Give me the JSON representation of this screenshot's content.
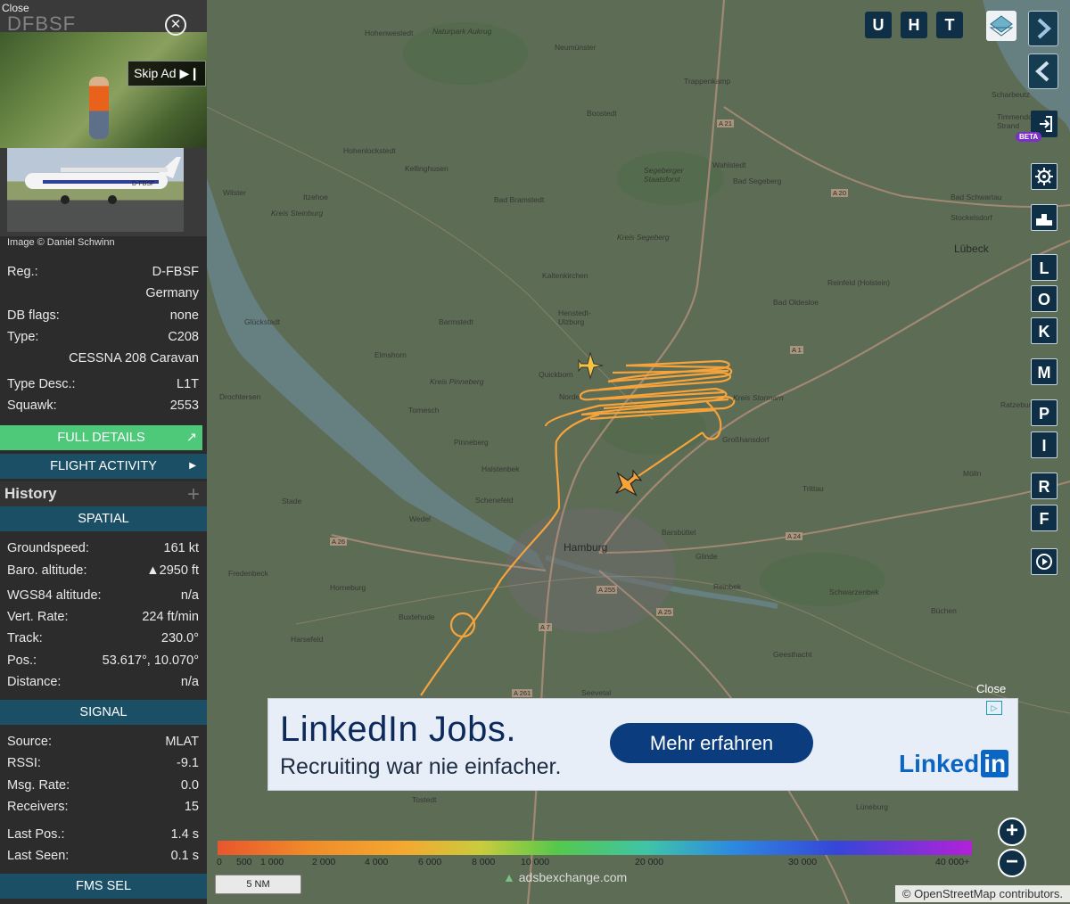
{
  "sidebar": {
    "ad": {
      "close_text": "Close",
      "ghost_text": "DFBSF",
      "skip_label": "Skip Ad"
    },
    "photo_credit": "Image © Daniel Schwinn",
    "aircraft": {
      "reg_label": "Reg.:",
      "reg_value": "D-FBSF",
      "country": "Germany",
      "dbflags_label": "DB flags:",
      "dbflags_value": "none",
      "type_label": "Type:",
      "type_value": "C208",
      "type_name": "CESSNA 208 Caravan",
      "typedesc_label": "Type Desc.:",
      "typedesc_value": "L1T",
      "squawk_label": "Squawk:",
      "squawk_value": "2553"
    },
    "full_details_label": "FULL DETAILS",
    "flight_activity_label": "FLIGHT ACTIVITY",
    "history_label": "History",
    "spatial": {
      "header": "SPATIAL",
      "groundspeed_label": "Groundspeed:",
      "groundspeed_value": "161 kt",
      "baro_label": "Baro. altitude:",
      "baro_value": "▲2950 ft",
      "wgs_label": "WGS84 altitude:",
      "wgs_value": "n/a",
      "vert_label": "Vert. Rate:",
      "vert_value": "224 ft/min",
      "track_label": "Track:",
      "track_value": "230.0°",
      "pos_label": "Pos.:",
      "pos_value": "53.617°, 10.070°",
      "dist_label": "Distance:",
      "dist_value": "n/a"
    },
    "signal": {
      "header": "SIGNAL",
      "source_label": "Source:",
      "source_value": "MLAT",
      "rssi_label": "RSSI:",
      "rssi_value": "-9.1",
      "msg_label": "Msg. Rate:",
      "msg_value": "0.0",
      "recv_label": "Receivers:",
      "recv_value": "15",
      "lastpos_label": "Last Pos.:",
      "lastpos_value": "1.4 s",
      "lastseen_label": "Last Seen:",
      "lastseen_value": "0.1 s"
    },
    "fms_label": "FMS SEL"
  },
  "map": {
    "top_buttons": [
      "U",
      "H",
      "T"
    ],
    "side_buttons": [
      "L",
      "O",
      "K",
      "M",
      "P",
      "I",
      "R",
      "F"
    ],
    "beta_badge": "BETA",
    "places": [
      {
        "name": "Hohenwestedt"
      },
      {
        "name": "Neumünster"
      },
      {
        "name": "Trappenkamp"
      },
      {
        "name": "Boostedt"
      },
      {
        "name": "Hohenlockstedt"
      },
      {
        "name": "Kellinghusen"
      },
      {
        "name": "Wahlstedt"
      },
      {
        "name": "Bad Segeberg"
      },
      {
        "name": "Wilster"
      },
      {
        "name": "Itzehoe"
      },
      {
        "name": "Bad Bramstedt"
      },
      {
        "name": "Bad Schwartau"
      },
      {
        "name": "Stockelsdorf"
      },
      {
        "name": "Lübeck"
      },
      {
        "name": "Kaltenkirchen"
      },
      {
        "name": "Reinfeld (Holstein)"
      },
      {
        "name": "Bad Oldesloe"
      },
      {
        "name": "Glückstadt"
      },
      {
        "name": "Barmstedt"
      },
      {
        "name": "Henstedt-Ulzburg"
      },
      {
        "name": "Elmshorn"
      },
      {
        "name": "Quickborn"
      },
      {
        "name": "Norde"
      },
      {
        "name": "Drochtersen"
      },
      {
        "name": "Tornesch"
      },
      {
        "name": "Pinneberg"
      },
      {
        "name": "Großhansdorf"
      },
      {
        "name": "Halstenbek"
      },
      {
        "name": "Schenefeld"
      },
      {
        "name": "Stade"
      },
      {
        "name": "Wedel"
      },
      {
        "name": "Trittau"
      },
      {
        "name": "Mölln"
      },
      {
        "name": "Hamburg"
      },
      {
        "name": "Barsbüttel"
      },
      {
        "name": "Fredenbeck"
      },
      {
        "name": "Glinde"
      },
      {
        "name": "Horneburg"
      },
      {
        "name": "Reinbek"
      },
      {
        "name": "Schwarzenbek"
      },
      {
        "name": "Buxtehude"
      },
      {
        "name": "Büchen"
      },
      {
        "name": "Harsefeld"
      },
      {
        "name": "Geesthacht"
      },
      {
        "name": "Seevetal"
      },
      {
        "name": "Tostedt"
      },
      {
        "name": "Lüneburg"
      },
      {
        "name": "Timmendorfer Strand"
      },
      {
        "name": "Scharbeutz"
      },
      {
        "name": "Ratzeburg"
      },
      {
        "name": "Kreis Steinburg"
      },
      {
        "name": "Kreis Segeberg"
      },
      {
        "name": "Kreis Pinneberg"
      },
      {
        "name": "Kreis Stormarn"
      },
      {
        "name": "Segeberger Staatsforst"
      },
      {
        "name": "Naturpark Aukrug"
      }
    ],
    "roads": [
      "A 21",
      "A 20",
      "A 1",
      "A 24",
      "A 26",
      "A 255",
      "A 25",
      "A 7",
      "A 261"
    ],
    "ad": {
      "close_text": "Close",
      "headline": "LinkedIn Jobs.",
      "subline": "Recruiting war nie einfacher.",
      "cta": "Mehr erfahren",
      "logo_text": "Linked",
      "logo_in": "in"
    },
    "legend_ticks": [
      "0",
      "500",
      "1 000",
      "2 000",
      "4 000",
      "6 000",
      "8 000",
      "10 000",
      "20 000",
      "30 000",
      "40 000+"
    ],
    "scale_label": "5 NM",
    "brand": "adsbexchange.com",
    "attribution": "© OpenStreetMap contributors.",
    "track_color": "#f5a33a"
  }
}
